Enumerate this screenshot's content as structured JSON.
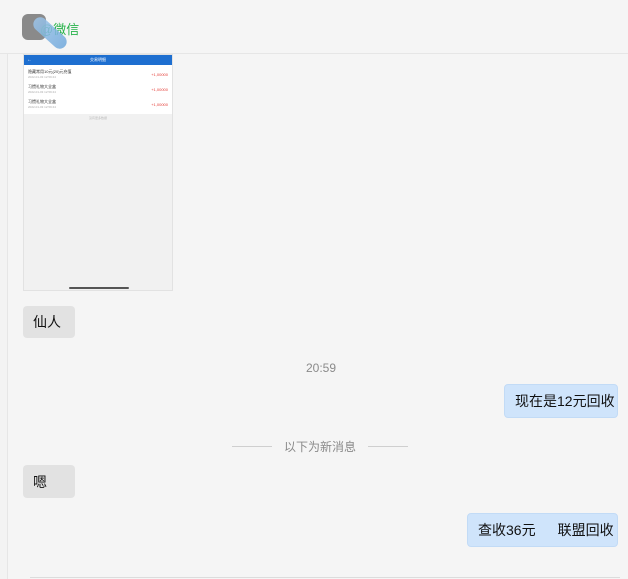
{
  "header": {
    "title": "@微信"
  },
  "thumbnail": {
    "title": "交易明细",
    "rows": [
      {
        "label": "隐藏常用10元(20)元充值",
        "date": "2022-01-03 12:59:44",
        "amount": "+1,00000"
      },
      {
        "label": "习惯礼物大全盒",
        "date": "2022-01-03 12:59:44",
        "amount": "+1,00000"
      },
      {
        "label": "习惯礼物大全盒",
        "date": "2022-01-03 12:59:44",
        "amount": "+1,00000"
      }
    ],
    "footer": "没有更多数据"
  },
  "messages": {
    "in1": "仙人",
    "time": "20:59",
    "out1": "现在是12元回收",
    "new_divider": "以下为新消息",
    "in2": "嗯",
    "out2_a": "查收36元",
    "out2_b": "联盟回收"
  }
}
